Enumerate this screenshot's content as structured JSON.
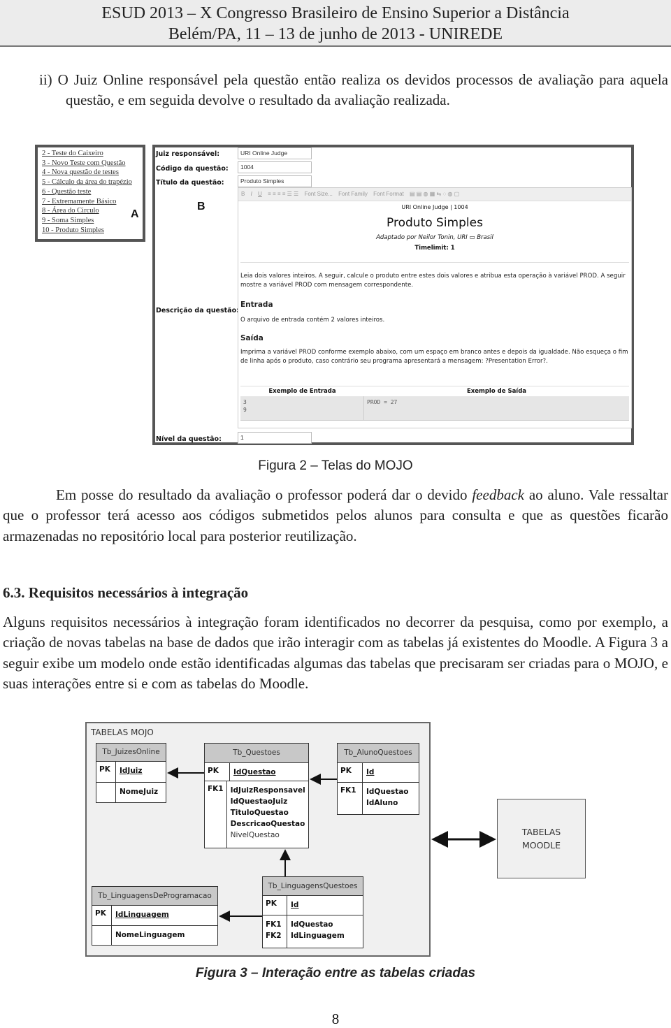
{
  "header": {
    "line1": "ESUD 2013 – X Congresso Brasileiro de Ensino Superior a Distância",
    "line2": "Belém/PA, 11 – 13 de junho de 2013 - UNIREDE"
  },
  "p1": "ii) O Juiz Online responsável pela questão então realiza os devidos processos de avaliação para aquela questão, e em seguida devolve o resultado da avaliação realizada.",
  "figure2": {
    "panel_a": {
      "label": "A",
      "items": [
        "2 - Teste do Caixeiro",
        "3 - Novo Teste com Questão",
        "4 - Nova questão de testes",
        "5 - Cálculo da área do trapézio",
        "6 - Questão teste",
        "7 - Extremamente Básico",
        "8 - Área do Circulo",
        "9 - Soma Simples",
        "10 - Produto Simples"
      ]
    },
    "panel_b": {
      "label": "B",
      "juiz_label": "Juiz responsável:",
      "juiz_value": "URI Online Judge",
      "codigo_label": "Código da questão:",
      "codigo_value": "1004",
      "titulo_label": "Título da questão:",
      "titulo_value": "Produto Simples",
      "descricao_label": "Descrição da questão:",
      "nivel_label": "Nível da questão:",
      "nivel_value": "1",
      "toolbar": {
        "bold": "B",
        "italic": "I",
        "underline": "U",
        "font_size": "Font Size...",
        "font_family": "Font Family",
        "font_format": "Font Format"
      },
      "editor": {
        "source": "URI Online Judge | 1004",
        "title": "Produto Simples",
        "author": "Adaptado por Neilor Tonin, URI ▭ Brasil",
        "timelimit": "Timelimit: 1",
        "intro": "Leia dois valores inteiros. A seguir, calcule o produto entre estes dois valores e atribua esta operação à variável PROD. A seguir mostre a variável PROD com mensagem correspondente.",
        "entrada_h": "Entrada",
        "entrada": "O arquivo de entrada contém 2 valores inteiros.",
        "saida_h": "Saída",
        "saida": "Imprima a variável PROD conforme exemplo abaixo, com um espaço em branco antes e depois da igualdade. Não esqueça o fim de linha após o produto, caso contrário seu programa apresentará a mensagem: ?Presentation Error?.",
        "ex_in_h": "Exemplo de Entrada",
        "ex_out_h": "Exemplo de Saída",
        "ex_in_1": "3",
        "ex_in_2": "9",
        "ex_out": "PROD = 27"
      }
    },
    "caption": "Figura 2 – Telas do MOJO"
  },
  "p2_pre": "Em posse do resultado da avaliação o professor poderá dar o devido ",
  "p2_em": "feedback",
  "p2_post": " ao aluno. Vale ressaltar que o professor terá acesso aos códigos submetidos pelos alunos para consulta e que as questões ficarão armazenadas no repositório local para posterior reutilização.",
  "h63": "6.3.  Requisitos necessários à integração",
  "p3": "Alguns requisitos necessários à integração foram identificados no decorrer da pesquisa, como por exemplo, a criação de novas tabelas na base de dados que irão interagir com as tabelas já existentes do Moodle. A Figura 3 a seguir exibe um modelo onde estão identificadas algumas das tabelas que precisaram ser criadas para o MOJO, e suas interações entre si e com as tabelas do Moodle.",
  "figure3": {
    "group_title": "TABELAS MOJO",
    "moodle_1": "TABELAS",
    "moodle_2": "MOODLE",
    "juizes": {
      "name": "Tb_JuizesOnline",
      "pk": "PK",
      "pk_field": "IdJuiz",
      "field": "NomeJuiz"
    },
    "questoes": {
      "name": "Tb_Questoes",
      "pk": "PK",
      "pk_field": "IdQuestao",
      "fk": "FK1",
      "fields": [
        "IdJuizResponsavel",
        "IdQuestaoJuiz",
        "TituloQuestao",
        "DescricaoQuestao",
        "NivelQuestao"
      ]
    },
    "aluno": {
      "name": "Tb_AlunoQuestoes",
      "pk": "PK",
      "pk_field": "Id",
      "fk": "FK1",
      "fields": [
        "IdQuestao",
        "IdAluno"
      ]
    },
    "lingprog": {
      "name": "Tb_LinguagensDeProgramacao",
      "pk": "PK",
      "pk_field": "IdLinguagem",
      "field": "NomeLinguagem"
    },
    "lingq": {
      "name": "Tb_LinguagensQuestoes",
      "pk": "PK",
      "pk_field": "Id",
      "fk1": "FK1",
      "fk2": "FK2",
      "fields": [
        "IdQuestao",
        "IdLinguagem"
      ]
    },
    "caption": "Figura 3 – Interação entre as tabelas criadas"
  },
  "page_number": "8"
}
